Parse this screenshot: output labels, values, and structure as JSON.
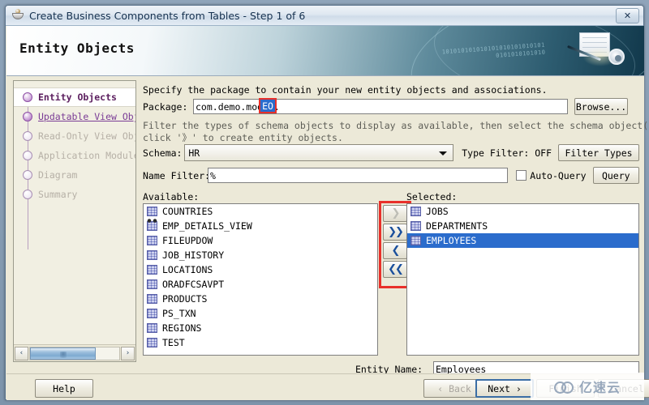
{
  "window": {
    "title": "Create Business Components from Tables - Step 1 of 6",
    "icon": "coffee-cup-icon",
    "close_label": "✕"
  },
  "banner": {
    "heading": "Entity Objects",
    "bits_line1": "101010101010101010101010101",
    "bits_line2": "0101010101010"
  },
  "sidebar": {
    "steps": [
      {
        "label": "Entity Objects",
        "state": "current"
      },
      {
        "label": "Updatable View Obje",
        "state": "link"
      },
      {
        "label": "Read-Only View Obje",
        "state": "disabled"
      },
      {
        "label": "Application Module",
        "state": "disabled"
      },
      {
        "label": "Diagram",
        "state": "disabled"
      },
      {
        "label": "Summary",
        "state": "disabled"
      }
    ],
    "scroll_left": "‹",
    "scroll_right": "›"
  },
  "main": {
    "package_hint": "Specify the package to contain your new entity objects and associations.",
    "package_label": "Package:",
    "package_value_prefix": "com.demo.model.",
    "package_value_highlight": "EO",
    "browse_label": "Browse...",
    "filter_hint_line1": "Filter the types of schema objects to display as available, then select the schema object(s) and",
    "filter_hint_line2": "click '》' to create entity objects.",
    "schema_label": "Schema:",
    "schema_value": "HR",
    "type_filter_label": "Type Filter: OFF",
    "filter_types_label": "Filter Types",
    "name_filter_label": "Name Filter:",
    "name_filter_value": "%",
    "auto_query_label": "Auto-Query",
    "query_label": "Query",
    "available_label": "Available:",
    "selected_label": "Selected:",
    "available_items": [
      {
        "name": "COUNTRIES",
        "icon": "table-icon"
      },
      {
        "name": "EMP_DETAILS_VIEW",
        "icon": "view-icon"
      },
      {
        "name": "FILEUPDOW",
        "icon": "table-icon"
      },
      {
        "name": "JOB_HISTORY",
        "icon": "table-icon"
      },
      {
        "name": "LOCATIONS",
        "icon": "table-icon"
      },
      {
        "name": "ORADFCSAVPT",
        "icon": "table-icon"
      },
      {
        "name": "PRODUCTS",
        "icon": "table-icon"
      },
      {
        "name": "PS_TXN",
        "icon": "table-icon"
      },
      {
        "name": "REGIONS",
        "icon": "table-icon"
      },
      {
        "name": "TEST",
        "icon": "table-icon"
      }
    ],
    "selected_items": [
      {
        "name": "JOBS",
        "icon": "table-icon",
        "selected": false
      },
      {
        "name": "DEPARTMENTS",
        "icon": "table-icon",
        "selected": false
      },
      {
        "name": "EMPLOYEES",
        "icon": "table-icon",
        "selected": true
      }
    ],
    "transfer_buttons": [
      {
        "name": "move-right",
        "glyph": "❯",
        "enabled": false
      },
      {
        "name": "move-all-right",
        "glyph": "❯❯",
        "enabled": true
      },
      {
        "name": "move-left",
        "glyph": "❮",
        "enabled": true
      },
      {
        "name": "move-all-left",
        "glyph": "❮❮",
        "enabled": true
      }
    ],
    "entity_name_label": "Entity Name:",
    "entity_name_value": "Employees"
  },
  "footer": {
    "help_label": "Help",
    "back_label": "‹ Back",
    "next_label": "Next ›",
    "finish_label": "Finish",
    "cancel_label": "Cancel"
  },
  "watermark": {
    "text": "亿速云"
  },
  "colors": {
    "accent": "#2b6ccc",
    "highlight_red": "#e8302a",
    "link_purple": "#7b3d96",
    "current_step": "#5c1f5f"
  }
}
